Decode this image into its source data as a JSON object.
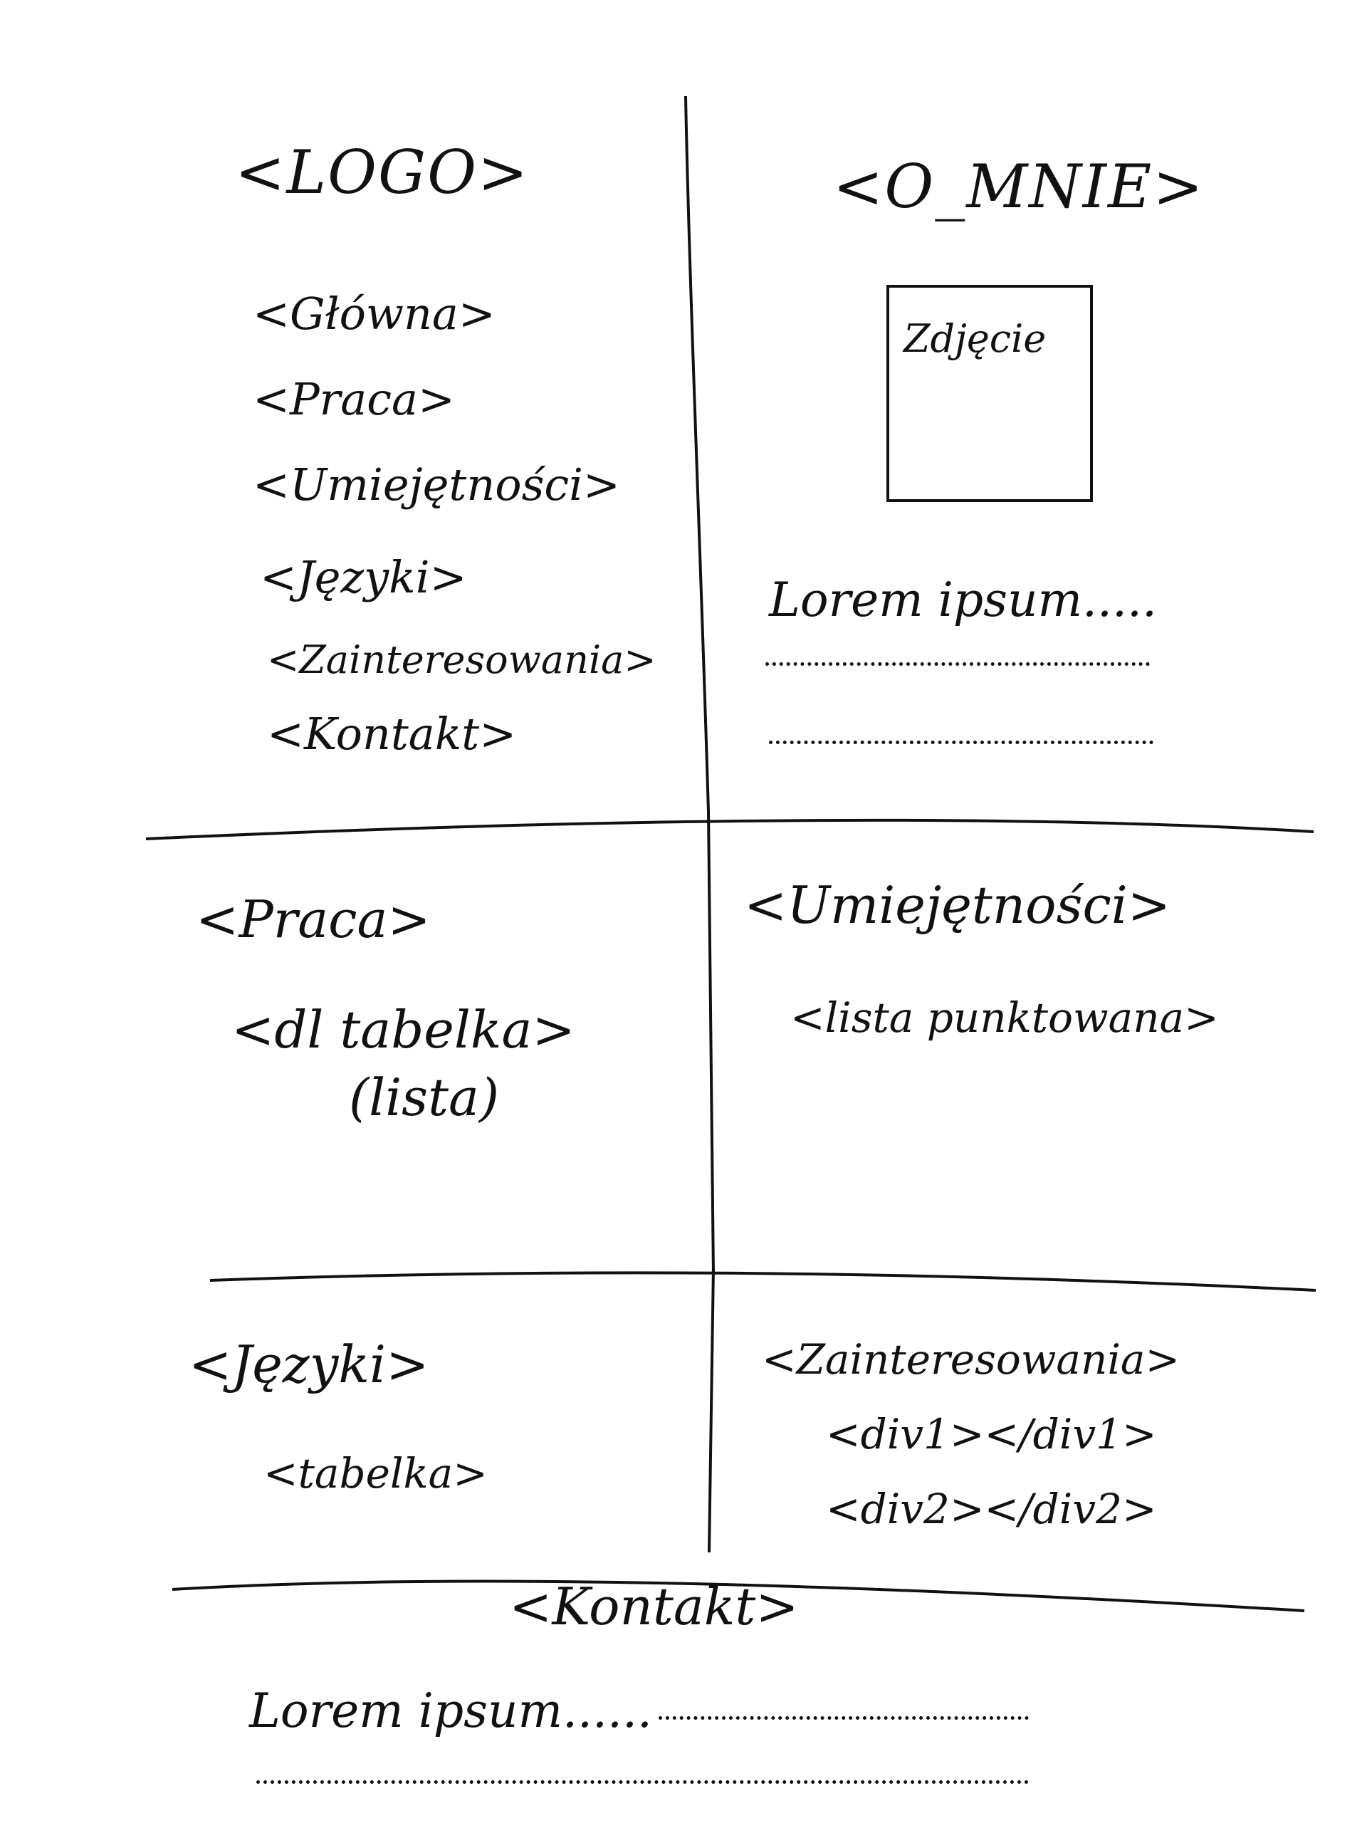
{
  "header": {
    "logo": "<LOGO>",
    "about_title": "<O_MNIE>"
  },
  "nav": {
    "items": [
      {
        "label": "<Główna>"
      },
      {
        "label": "<Praca>"
      },
      {
        "label": "<Umiejętności>"
      },
      {
        "label": "<Języki>"
      },
      {
        "label": "<Zainteresowania>"
      },
      {
        "label": "<Kontakt>"
      }
    ]
  },
  "about": {
    "photo_label": "Zdjęcie",
    "text": "Lorem ipsum....."
  },
  "work": {
    "title": "<Praca>",
    "content": "<dl tabelka>",
    "content_note": "(lista)"
  },
  "skills": {
    "title": "<Umiejętności>",
    "content": "<lista punktowana>"
  },
  "languages": {
    "title": "<Języki>",
    "content": "<tabelka>"
  },
  "interests": {
    "title": "<Zainteresowania>",
    "div1": "<div1></div1>",
    "div2": "<div2></div2>"
  },
  "contact": {
    "title": "<Kontakt>",
    "text": "Lorem ipsum......"
  }
}
